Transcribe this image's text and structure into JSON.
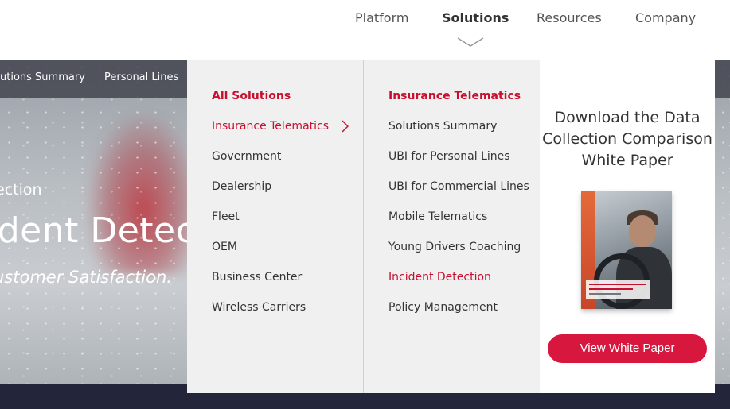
{
  "topnav": {
    "items": [
      {
        "label": "Platform"
      },
      {
        "label": "Solutions"
      },
      {
        "label": "Resources"
      },
      {
        "label": "Company"
      }
    ]
  },
  "subnav": {
    "items": [
      {
        "label": "utions Summary"
      },
      {
        "label": "Personal Lines"
      }
    ]
  },
  "hero": {
    "kicker": "ection",
    "title": "ident Detectio",
    "subtitle": "ustomer Satisfaction."
  },
  "mega_menu": {
    "column1": {
      "items": [
        {
          "label": "All Solutions"
        },
        {
          "label": "Insurance Telematics"
        },
        {
          "label": "Government"
        },
        {
          "label": "Dealership"
        },
        {
          "label": "Fleet"
        },
        {
          "label": "OEM"
        },
        {
          "label": "Business Center"
        },
        {
          "label": "Wireless Carriers"
        }
      ]
    },
    "column2": {
      "items": [
        {
          "label": "Insurance Telematics"
        },
        {
          "label": "Solutions Summary"
        },
        {
          "label": "UBI for Personal Lines"
        },
        {
          "label": "UBI for Commercial Lines"
        },
        {
          "label": "Mobile Telematics"
        },
        {
          "label": "Young Drivers Coaching"
        },
        {
          "label": "Incident Detection"
        },
        {
          "label": "Policy Management"
        }
      ]
    },
    "promo": {
      "title_lines": [
        "Download the Data",
        "Collection Comparison",
        "White Paper"
      ],
      "button_label": "View White Paper"
    }
  },
  "colors": {
    "accent_red": "#c8102e",
    "button_red": "#d8173f",
    "text": "#333333",
    "menu_bg": "#f0f0f0",
    "footer_band": "#23253a"
  }
}
